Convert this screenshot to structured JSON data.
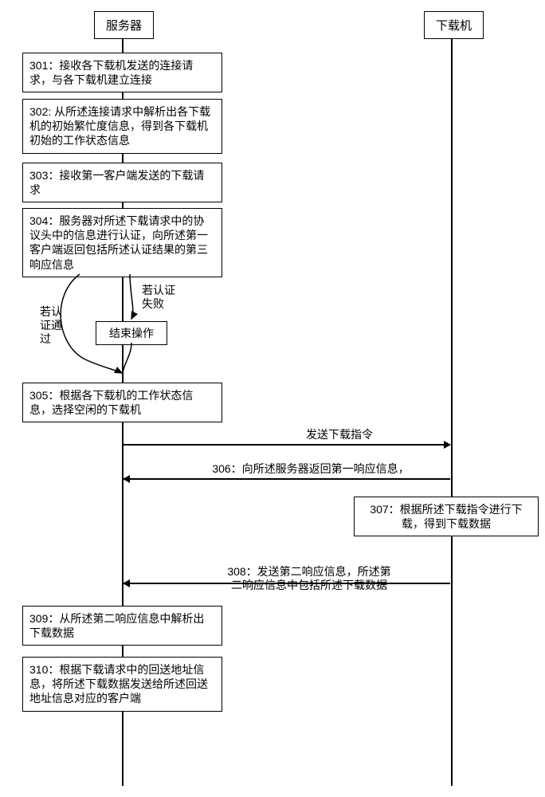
{
  "participants": {
    "server": "服务器",
    "downloader": "下载机"
  },
  "steps": {
    "s301": "301：接收各下载机发送的连接请求，与各下载机建立连接",
    "s302": "302: 从所述连接请求中解析出各下载机的初始繁忙度信息，得到各下载机初始的工作状态信息",
    "s303": "303：接收第一客户端发送的下载请求",
    "s304": "304：服务器对所述下载请求中的协议头中的信息进行认证，向所述第一客户端返回包括所述认证结果的第三响应信息",
    "s305": "305：根据各下载机的工作状态信息，选择空闲的下载机",
    "s307": "307：根据所述下载指令进行下载，得到下载数据",
    "s309": "309：从所述第二响应信息中解析出下载数据",
    "s310": "310：根据下载请求中的回送地址信息，将所述下载数据发送给所述回送地址信息对应的客户端"
  },
  "end_op": "结束操作",
  "branches": {
    "fail": "若认证\n失败",
    "pass": "若认\n证通\n过"
  },
  "messages": {
    "m_send_cmd": "发送下载指令",
    "m_306": "306：向所述服务器返回第一响应信息，",
    "m_308": "308：发送第二响应信息，所述第\n二响应信息中包括所述下载数据"
  }
}
